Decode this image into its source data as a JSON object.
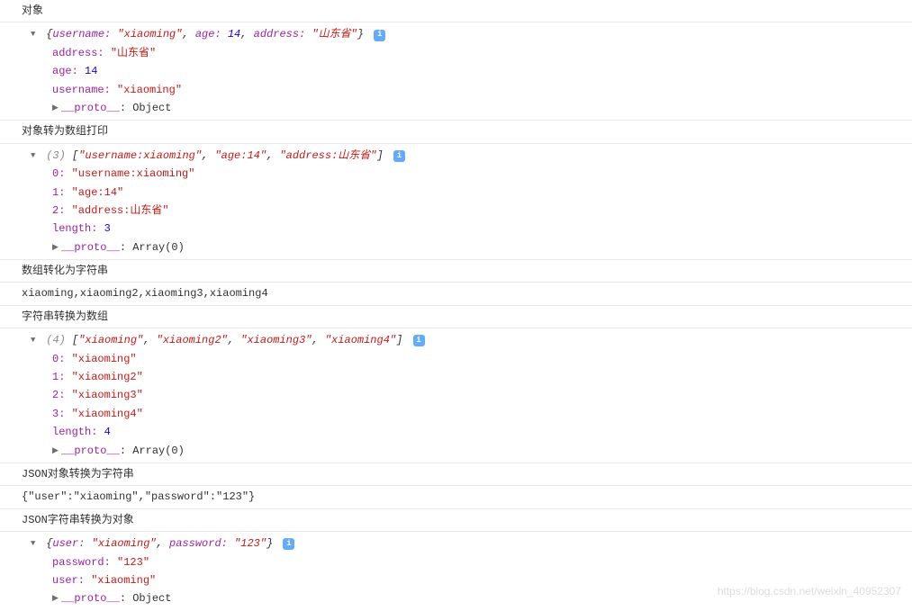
{
  "sections": {
    "obj_title": "对象",
    "obj_summary_parts": {
      "open": "{",
      "k1": "username:",
      "v1": "\"xiaoming\"",
      "k2": "age:",
      "v2": "14",
      "k3": "address:",
      "v3": "\"山东省\"",
      "close": "}"
    },
    "obj_props": {
      "address_k": "address:",
      "address_v": "\"山东省\"",
      "age_k": "age:",
      "age_v": "14",
      "username_k": "username:",
      "username_v": "\"xiaoming\"",
      "proto_k": "__proto__",
      "proto_v": ": Object"
    },
    "arr1_title": "对象转为数组打印",
    "arr1_summary": {
      "len": "(3)",
      "open": " [",
      "v0": "\"username:xiaoming\"",
      "v1": "\"age:14\"",
      "v2": "\"address:山东省\"",
      "close": "]"
    },
    "arr1_items": {
      "k0": "0:",
      "v0": "\"username:xiaoming\"",
      "k1": "1:",
      "v1": "\"age:14\"",
      "k2": "2:",
      "v2": "\"address:山东省\"",
      "len_k": "length:",
      "len_v": "3",
      "proto_k": "__proto__",
      "proto_v": ": Array(0)"
    },
    "tostr_title": "数组转化为字符串",
    "tostr_value": "xiaoming,xiaoming2,xiaoming3,xiaoming4",
    "toarr_title": "字符串转换为数组",
    "arr2_summary": {
      "len": "(4)",
      "open": " [",
      "v0": "\"xiaoming\"",
      "v1": "\"xiaoming2\"",
      "v2": "\"xiaoming3\"",
      "v3": "\"xiaoming4\"",
      "close": "]"
    },
    "arr2_items": {
      "k0": "0:",
      "v0": "\"xiaoming\"",
      "k1": "1:",
      "v1": "\"xiaoming2\"",
      "k2": "2:",
      "v2": "\"xiaoming3\"",
      "k3": "3:",
      "v3": "\"xiaoming4\"",
      "len_k": "length:",
      "len_v": "4",
      "proto_k": "__proto__",
      "proto_v": ": Array(0)"
    },
    "jsonstr_title": "JSON对象转换为字符串",
    "jsonstr_value": "{\"user\":\"xiaoming\",\"password\":\"123\"}",
    "jsonobj_title": "JSON字符串转换为对象",
    "jsonobj_summary": {
      "open": "{",
      "k1": "user:",
      "v1": "\"xiaoming\"",
      "k2": "password:",
      "v2": "\"123\"",
      "close": "}"
    },
    "jsonobj_props": {
      "password_k": "password:",
      "password_v": "\"123\"",
      "user_k": "user:",
      "user_v": "\"xiaoming\"",
      "proto_k": "__proto__",
      "proto_v": ": Object"
    }
  },
  "info_glyph": "i",
  "sep": ", ",
  "watermark": "https://blog.csdn.net/weixin_40952307"
}
